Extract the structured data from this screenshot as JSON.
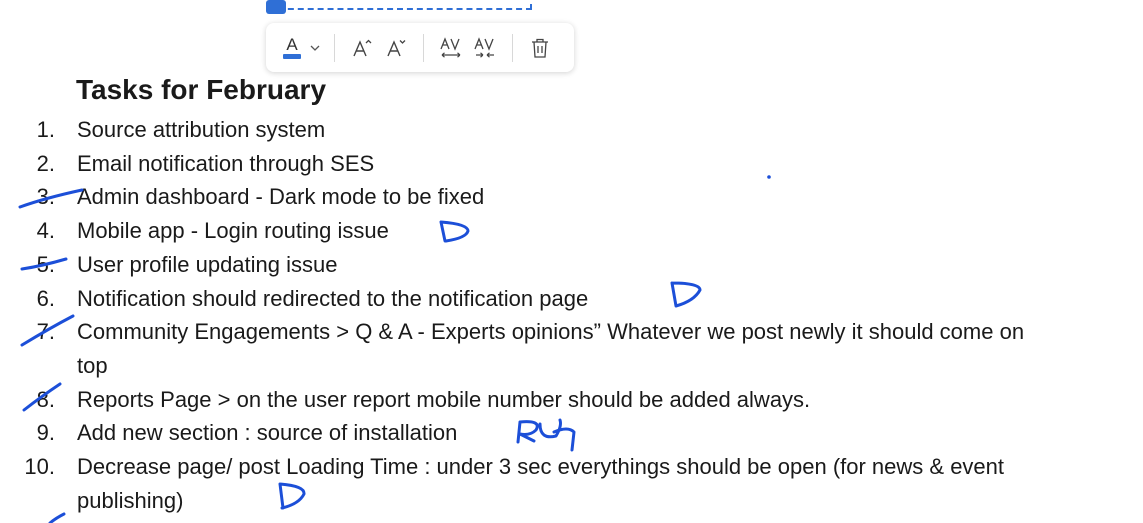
{
  "colors": {
    "ink": "#1c4fd8",
    "selection": "#2f6fd6",
    "font_color_swatch": "#2f6fd6",
    "text": "#1a1a1a"
  },
  "toolbar": {
    "font_color": {
      "glyph": "A",
      "icon": "font-color-icon",
      "dropdown_icon": "chevron-down-icon"
    },
    "increase_font": {
      "glyph": "Aˆ",
      "icon": "increase-font-size-icon"
    },
    "decrease_font": {
      "glyph": "Aˇ",
      "icon": "decrease-font-size-icon"
    },
    "expand_spacing": {
      "glyph": "AV",
      "icon": "expand-character-spacing-icon"
    },
    "condense_spacing": {
      "glyph": "AV",
      "icon": "condense-character-spacing-icon"
    },
    "delete": {
      "icon": "trash-icon"
    }
  },
  "note": {
    "title": "Tasks for February",
    "tasks": [
      {
        "num": "1.",
        "text": "Source attribution system"
      },
      {
        "num": "2.",
        "text": "Email notification through SES"
      },
      {
        "num": "3.",
        "text": "Admin dashboard - Dark mode to be fixed"
      },
      {
        "num": "4.",
        "text": "Mobile app - Login routing issue"
      },
      {
        "num": "5.",
        "text": "User profile updating issue"
      },
      {
        "num": "6.",
        "text": "Notification should redirected to the notification page"
      },
      {
        "num": "7.",
        "text": "Community Engagements > Q & A - Experts opinions” Whatever we post newly it should come on top"
      },
      {
        "num": "8.",
        "text": "Reports Page > on the user report mobile number should be added always."
      },
      {
        "num": "9.",
        "text": "Add new section : source of installation"
      },
      {
        "num": "10.",
        "text": "Decrease page/ post Loading Time : under 3 sec everythings should be open (for news & event publishing)"
      }
    ]
  }
}
